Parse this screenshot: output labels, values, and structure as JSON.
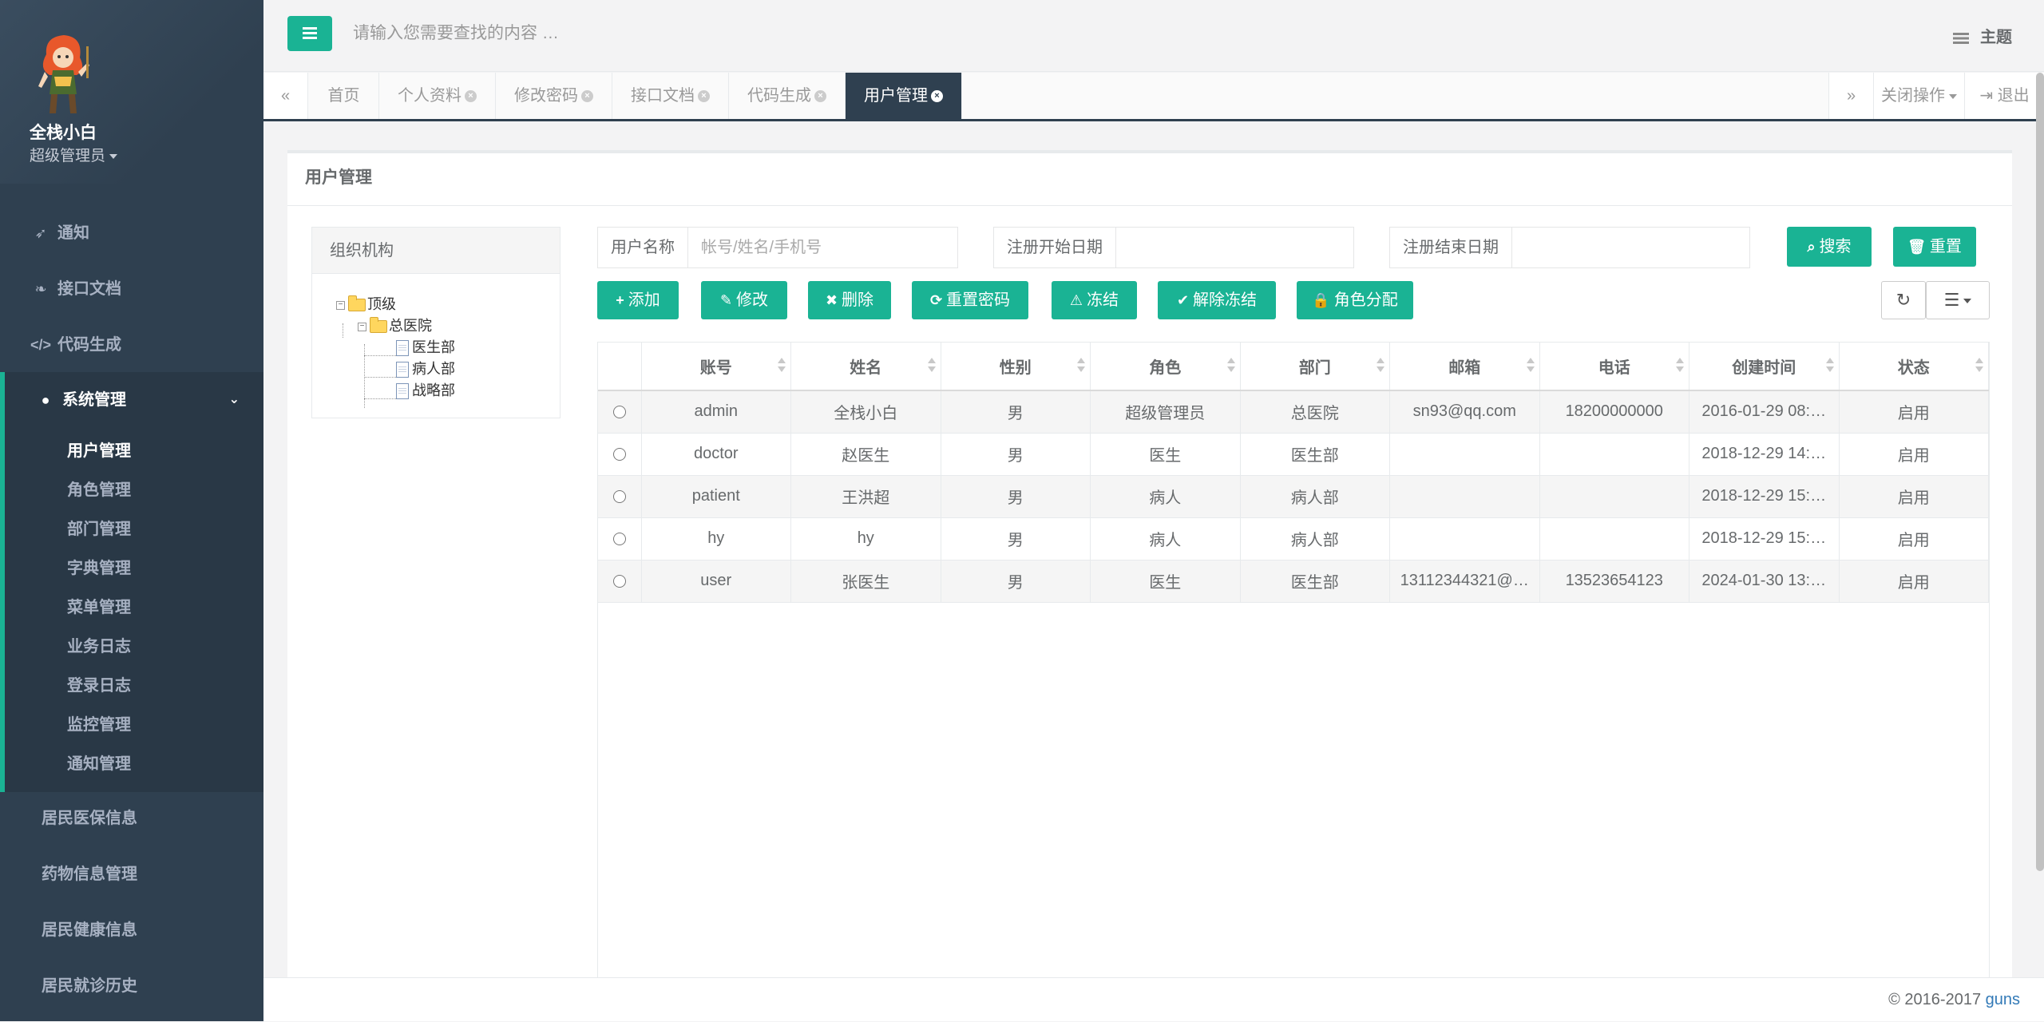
{
  "sidebar": {
    "user_name": "全栈小白",
    "user_role": "超级管理员",
    "nav": [
      {
        "label": "通知",
        "icon": "rocket-icon"
      },
      {
        "label": "接口文档",
        "icon": "leaf-icon"
      },
      {
        "label": "代码生成",
        "icon": "code-icon"
      }
    ],
    "active_group": {
      "label": "系统管理",
      "icon": "user-icon",
      "items": [
        "用户管理",
        "角色管理",
        "部门管理",
        "字典管理",
        "菜单管理",
        "业务日志",
        "登录日志",
        "监控管理",
        "通知管理"
      ],
      "active_index": 0
    },
    "more": [
      "居民医保信息",
      "药物信息管理",
      "居民健康信息",
      "居民就诊历史"
    ]
  },
  "header": {
    "search_placeholder": "请输入您需要查找的内容 …",
    "theme_label": "主题"
  },
  "tabs": {
    "items": [
      {
        "label": "首页",
        "closable": false
      },
      {
        "label": "个人资料",
        "closable": true
      },
      {
        "label": "修改密码",
        "closable": true
      },
      {
        "label": "接口文档",
        "closable": true
      },
      {
        "label": "代码生成",
        "closable": true
      },
      {
        "label": "用户管理",
        "closable": true,
        "active": true
      }
    ],
    "close_ops": "关闭操作",
    "logout": "退出"
  },
  "panel": {
    "title": "用户管理",
    "org_title": "组织机构",
    "tree": {
      "root": "顶级",
      "child": "总医院",
      "leaves": [
        "医生部",
        "病人部",
        "战略部"
      ]
    },
    "filters": {
      "name_label": "用户名称",
      "name_placeholder": "帐号/姓名/手机号",
      "start_label": "注册开始日期",
      "end_label": "注册结束日期",
      "search": "搜索",
      "reset": "重置"
    },
    "actions": {
      "add": "添加",
      "edit": "修改",
      "delete": "删除",
      "reset_pwd": "重置密码",
      "freeze": "冻结",
      "unfreeze": "解除冻结",
      "assign_role": "角色分配"
    },
    "table": {
      "columns": [
        "账号",
        "姓名",
        "性别",
        "角色",
        "部门",
        "邮箱",
        "电话",
        "创建时间",
        "状态"
      ],
      "rows": [
        [
          "admin",
          "全栈小白",
          "男",
          "超级管理员",
          "总医院",
          "sn93@qq.com",
          "18200000000",
          "2016-01-29 08:…",
          "启用"
        ],
        [
          "doctor",
          "赵医生",
          "男",
          "医生",
          "医生部",
          "",
          "",
          "2018-12-29 14:…",
          "启用"
        ],
        [
          "patient",
          "王洪超",
          "男",
          "病人",
          "病人部",
          "",
          "",
          "2018-12-29 15:…",
          "启用"
        ],
        [
          "hy",
          "hy",
          "男",
          "病人",
          "病人部",
          "",
          "",
          "2018-12-29 15:…",
          "启用"
        ],
        [
          "user",
          "张医生",
          "男",
          "医生",
          "医生部",
          "13112344321@…",
          "13523654123",
          "2024-01-30 13:…",
          "启用"
        ]
      ]
    }
  },
  "footer": {
    "copyright": "© 2016-2017",
    "link": "guns"
  },
  "colors": {
    "accent": "#1ab394",
    "sidebar_bg": "#2f4050",
    "sidebar_active_bg": "#293846"
  }
}
